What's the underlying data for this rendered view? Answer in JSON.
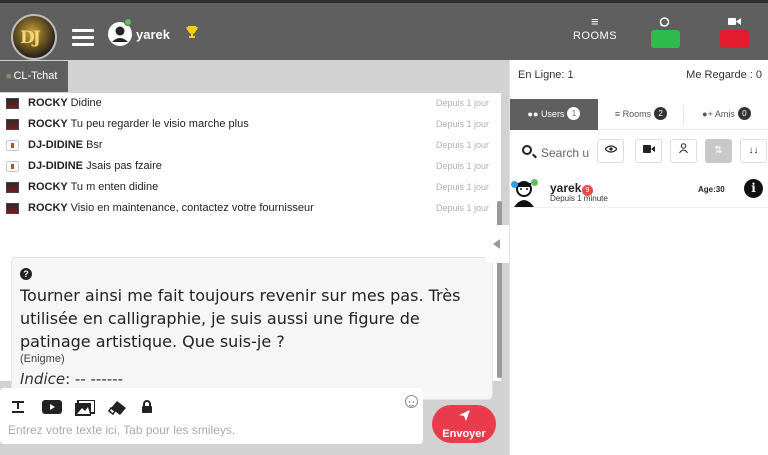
{
  "topbar": {
    "username": "yarek",
    "rooms_label": "ROOMS",
    "icons": [
      "logo",
      "menu-icon",
      "user-avatar-icon",
      "trophy-icon",
      "list-icon",
      "chat-bubble-icon",
      "video-camera-icon"
    ]
  },
  "channel": {
    "tab_label": "CL-Tchat"
  },
  "messages": [
    {
      "nick": "ROCKY",
      "text": "Didine",
      "time": "Depuis 1 jour",
      "avatar": "rocky"
    },
    {
      "nick": "ROCKY",
      "text": "Tu peu regarder le visio marche plus",
      "time": "Depuis 1 jour",
      "avatar": "rocky"
    },
    {
      "nick": "DJ-DIDINE",
      "text": "Bsr",
      "time": "Depuis 1 jour",
      "avatar": "dj"
    },
    {
      "nick": "DJ-DIDINE",
      "text": "Jsais pas fzaire",
      "time": "Depuis 1 jour",
      "avatar": "dj"
    },
    {
      "nick": "ROCKY",
      "text": "Tu m enten didine",
      "time": "Depuis 1 jour",
      "avatar": "rocky"
    },
    {
      "nick": "ROCKY",
      "text": "Visio en maintenance, contactez votre fournisseur",
      "time": "Depuis 1 jour",
      "avatar": "rocky"
    }
  ],
  "riddle": {
    "question_icon": "?",
    "text": "Tourner ainsi me fait toujours revenir sur mes pas. Très utilisée en calligraphie, je suis aussi une figure de patinage artistique. Que suis-je ?",
    "category": "(Enigme)",
    "hint_label": "Indice",
    "hint_value": ": -- ------"
  },
  "composer": {
    "placeholder": "Entrez votre texte ici, Tab pour les smileys.",
    "send_label": "Envoyer"
  },
  "right": {
    "online": "En Ligne: 1",
    "watching": "Me Regarde : 0",
    "tabs": [
      {
        "label": "Users",
        "count": "1"
      },
      {
        "label": "Rooms",
        "count": "2"
      },
      {
        "label": "Amis",
        "count": "0"
      }
    ],
    "search_placeholder": "Search u",
    "users": [
      {
        "name": "yarek",
        "badge": "9",
        "since": "Depuis 1 minute",
        "age": "Age:30"
      }
    ]
  }
}
